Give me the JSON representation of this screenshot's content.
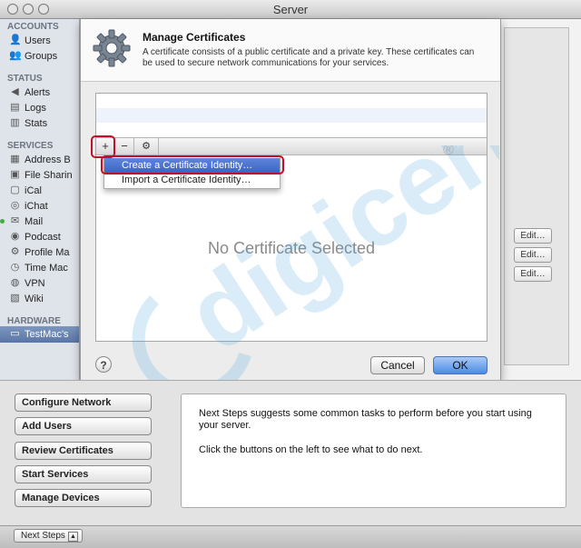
{
  "window": {
    "title": "Server"
  },
  "sidebar": {
    "sections": [
      {
        "label": "ACCOUNTS",
        "items": [
          {
            "label": "Users",
            "icon": "user-icon"
          },
          {
            "label": "Groups",
            "icon": "group-icon"
          }
        ]
      },
      {
        "label": "STATUS",
        "items": [
          {
            "label": "Alerts",
            "icon": "alerts-icon"
          },
          {
            "label": "Logs",
            "icon": "logs-icon"
          },
          {
            "label": "Stats",
            "icon": "stats-icon"
          }
        ]
      },
      {
        "label": "SERVICES",
        "items": [
          {
            "label": "Address B",
            "icon": "address-book-icon"
          },
          {
            "label": "File Sharin",
            "icon": "file-sharing-icon"
          },
          {
            "label": "iCal",
            "icon": "ical-icon"
          },
          {
            "label": "iChat",
            "icon": "ichat-icon"
          },
          {
            "label": "Mail",
            "icon": "mail-icon"
          },
          {
            "label": "Podcast",
            "icon": "podcast-icon"
          },
          {
            "label": "Profile Ma",
            "icon": "profile-manager-icon"
          },
          {
            "label": "Time Mac",
            "icon": "time-machine-icon"
          },
          {
            "label": "VPN",
            "icon": "vpn-icon"
          },
          {
            "label": "Wiki",
            "icon": "wiki-icon"
          }
        ]
      },
      {
        "label": "HARDWARE",
        "items": [
          {
            "label": "TestMac's",
            "icon": "computer-icon"
          }
        ]
      }
    ]
  },
  "sheet": {
    "title": "Manage Certificates",
    "description": "A certificate consists of a public certificate and a private key. These certificates can be used to secure network communications for your services.",
    "toolbar": {
      "add": "+",
      "remove": "−",
      "action": "⚙"
    },
    "menu": {
      "items": [
        "Create a Certificate Identity…",
        "Import a Certificate Identity…"
      ],
      "selected_index": 0
    },
    "empty_text": "No Certificate Selected",
    "help": "?",
    "cancel_label": "Cancel",
    "ok_label": "OK"
  },
  "right_panel": {
    "edit_label": "Edit…"
  },
  "tasks": [
    "Configure Network",
    "Add Users",
    "Review Certificates",
    "Start Services",
    "Manage Devices"
  ],
  "next_steps": {
    "para1": "Next Steps suggests some common tasks to perform before you start using your server.",
    "para2": "Click the buttons on the left to see what to do next.",
    "button_label": "Next Steps"
  },
  "watermark": {
    "text": "digicert",
    "registered": "®"
  },
  "colors": {
    "highlight": "#c0112b",
    "selection": "#3b63c9",
    "watermark": "#4aa3e0"
  }
}
